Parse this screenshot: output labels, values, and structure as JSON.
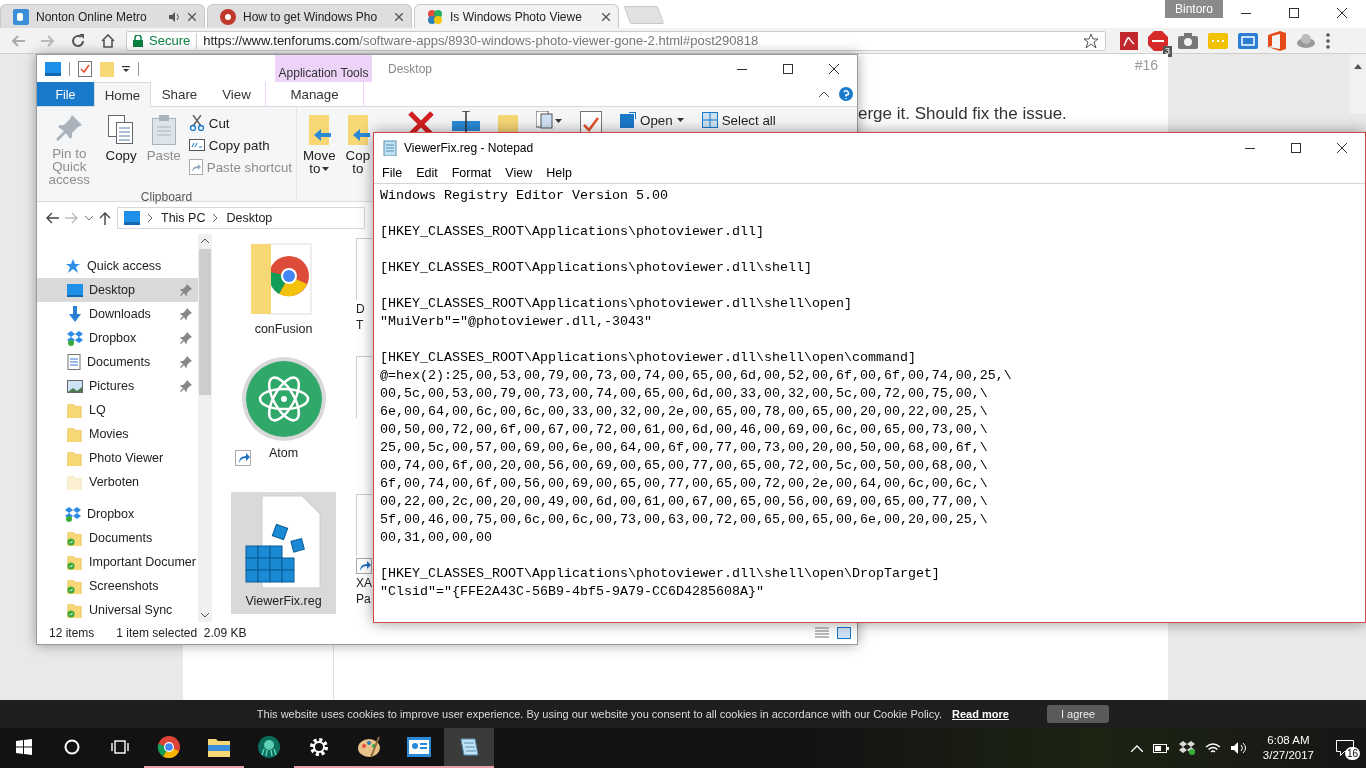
{
  "browser": {
    "tabs": [
      {
        "title": "Nonton Online Metro",
        "kind": "tile",
        "audio": true,
        "selected": false
      },
      {
        "title": "How to get Windows Pho",
        "kind": "badge",
        "audio": false,
        "selected": false
      },
      {
        "title": "Is Windows Photo Viewe",
        "kind": "pinwheel",
        "audio": false,
        "selected": true
      }
    ],
    "profile": "Bintoro",
    "secure_label": "Secure",
    "url_host": "https://www.tenforums.com",
    "url_path": "/software-apps/8930-windows-photo-viewer-gone-2.html#post290818",
    "extension_badge": "3",
    "post": {
      "number": "#16",
      "text": "erge it. Should fix the issue."
    }
  },
  "explorer": {
    "context_tab": "Application Tools",
    "title": "Desktop",
    "ribbon_tabs": [
      {
        "label": "File",
        "kind": "file",
        "selected": false
      },
      {
        "label": "Home",
        "kind": "tab",
        "selected": true
      },
      {
        "label": "Share",
        "kind": "tab",
        "selected": false
      },
      {
        "label": "View",
        "kind": "tab",
        "selected": false
      },
      {
        "label": "Manage",
        "kind": "context",
        "selected": false
      }
    ],
    "clipboard": {
      "group": "Clipboard",
      "large": [
        {
          "label": "Pin to Quick\naccess",
          "kind": "pin",
          "disabled": true
        },
        {
          "label": "Copy",
          "kind": "copy",
          "disabled": false
        },
        {
          "label": "Paste",
          "kind": "paste",
          "disabled": true
        }
      ],
      "small": [
        {
          "label": "Cut",
          "kind": "scissors",
          "disabled": false
        },
        {
          "label": "Copy path",
          "kind": "path",
          "disabled": false
        },
        {
          "label": "Paste shortcut",
          "kind": "shortcut",
          "disabled": true
        }
      ]
    },
    "organize": [
      {
        "label": "Move\nto",
        "menu": true
      },
      {
        "label": "Cop\nto",
        "menu": false
      }
    ],
    "open_label": "Open",
    "select_all_label": "Select all",
    "path": [
      "This PC",
      "Desktop"
    ],
    "nav": [
      {
        "label": "Quick access",
        "kind": "star",
        "children": [
          {
            "label": "Desktop",
            "kind": "desktop",
            "pinned": true,
            "selected": true
          },
          {
            "label": "Downloads",
            "kind": "download",
            "pinned": true,
            "selected": false
          },
          {
            "label": "Dropbox",
            "kind": "dropbox",
            "pinned": true,
            "selected": false
          },
          {
            "label": "Documents",
            "kind": "document",
            "pinned": true,
            "selected": false
          },
          {
            "label": "Pictures",
            "kind": "pictures",
            "pinned": true,
            "selected": false
          },
          {
            "label": "LQ",
            "kind": "folder",
            "pinned": false,
            "selected": false
          },
          {
            "label": "Movies",
            "kind": "folder",
            "pinned": false,
            "selected": false
          },
          {
            "label": "Photo Viewer",
            "kind": "folder",
            "pinned": false,
            "selected": false
          },
          {
            "label": "Verboten",
            "kind": "folder-faded",
            "pinned": false,
            "selected": false
          }
        ]
      },
      {
        "label": "Dropbox",
        "kind": "dropbox",
        "children": [
          {
            "label": "Documents",
            "kind": "folder-synced",
            "pinned": false,
            "selected": false
          },
          {
            "label": "Important Documer",
            "kind": "folder-synced",
            "pinned": false,
            "selected": false
          },
          {
            "label": "Screenshots",
            "kind": "folder-synced",
            "pinned": false,
            "selected": false
          },
          {
            "label": "Universal Sync",
            "kind": "folder-synced",
            "pinned": false,
            "selected": false
          }
        ]
      }
    ],
    "file_columns": [
      [
        {
          "lines": [
            "conFusion"
          ],
          "kind": "chrome-folder",
          "shortcut": false,
          "selected": false
        },
        {
          "lines": [
            "Atom"
          ],
          "kind": "atom",
          "shortcut": true,
          "selected": false
        },
        {
          "lines": [
            "ViewerFix.reg"
          ],
          "kind": "registry",
          "shortcut": false,
          "selected": true
        }
      ],
      [
        {
          "lines": [
            "D",
            "T"
          ],
          "kind": "frame",
          "shortcut": false,
          "selected": false
        },
        {
          "kind": "frame",
          "shortcut": false,
          "selected": false
        },
        {
          "lines": [
            "XA",
            "Pa"
          ],
          "kind": "frame",
          "shortcut": true,
          "selected": false
        }
      ]
    ],
    "status": {
      "count": "12 items",
      "selection": "1 item selected",
      "size": "2.09 KB"
    }
  },
  "notepad": {
    "title": "ViewerFix.reg - Notepad",
    "menu": [
      "File",
      "Edit",
      "Format",
      "View",
      "Help"
    ],
    "blocks": [
      [
        "Windows Registry Editor Version 5.00"
      ],
      [
        "[HKEY_CLASSES_ROOT\\Applications\\photoviewer.dll]"
      ],
      [
        "[HKEY_CLASSES_ROOT\\Applications\\photoviewer.dll\\shell]"
      ],
      [
        "[HKEY_CLASSES_ROOT\\Applications\\photoviewer.dll\\shell\\open]",
        "\"MuiVerb\"=\"@photoviewer.dll,-3043\""
      ],
      [
        "[HKEY_CLASSES_ROOT\\Applications\\photoviewer.dll\\shell\\open\\command]",
        "@=hex(2):25,00,53,00,79,00,73,00,74,00,65,00,6d,00,52,00,6f,00,6f,00,74,00,25,\\",
        "00,5c,00,53,00,79,00,73,00,74,00,65,00,6d,00,33,00,32,00,5c,00,72,00,75,00,\\",
        "6e,00,64,00,6c,00,6c,00,33,00,32,00,2e,00,65,00,78,00,65,00,20,00,22,00,25,\\",
        "00,50,00,72,00,6f,00,67,00,72,00,61,00,6d,00,46,00,69,00,6c,00,65,00,73,00,\\",
        "25,00,5c,00,57,00,69,00,6e,00,64,00,6f,00,77,00,73,00,20,00,50,00,68,00,6f,\\",
        "00,74,00,6f,00,20,00,56,00,69,00,65,00,77,00,65,00,72,00,5c,00,50,00,68,00,\\",
        "6f,00,74,00,6f,00,56,00,69,00,65,00,77,00,65,00,72,00,2e,00,64,00,6c,00,6c,\\",
        "00,22,00,2c,00,20,00,49,00,6d,00,61,00,67,00,65,00,56,00,69,00,65,00,77,00,\\",
        "5f,00,46,00,75,00,6c,00,6c,00,73,00,63,00,72,00,65,00,65,00,6e,00,20,00,25,\\",
        "00,31,00,00,00"
      ],
      [
        "[HKEY_CLASSES_ROOT\\Applications\\photoviewer.dll\\shell\\open\\DropTarget]",
        "\"Clsid\"=\"{FFE2A43C-56B9-4bf5-9A79-CC6D4285608A}\""
      ]
    ]
  },
  "cookie_bar": {
    "text": "This website uses cookies to improve user experience. By using our website you consent to all cookies in accordance with our Cookie Policy.",
    "link": "Read more",
    "button": "I agree"
  },
  "taskbar": {
    "apps": [
      {
        "kind": "chrome",
        "running": true,
        "selected": false
      },
      {
        "kind": "explorer",
        "running": true,
        "selected": false
      },
      {
        "kind": "kraken",
        "running": false,
        "selected": false
      },
      {
        "kind": "settings",
        "running": true,
        "selected": false
      },
      {
        "kind": "paint",
        "running": true,
        "selected": false
      },
      {
        "kind": "contact",
        "running": true,
        "selected": false
      },
      {
        "kind": "notepad",
        "running": true,
        "selected": true
      }
    ],
    "time": "6:08 AM",
    "date": "3/27/2017",
    "notifications": "16"
  }
}
